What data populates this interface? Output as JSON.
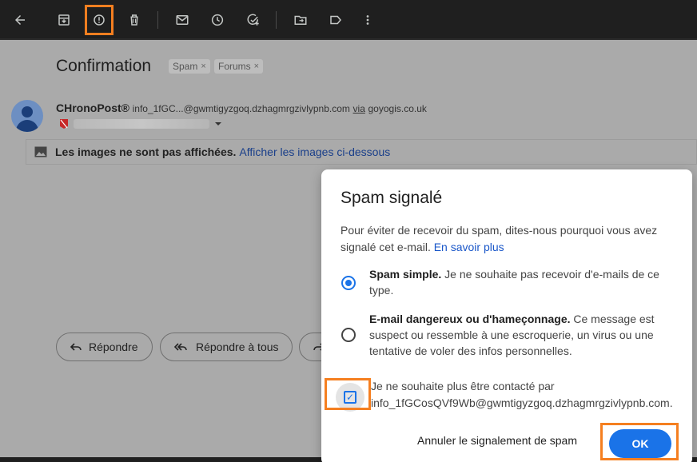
{
  "toolbar": {
    "icons": [
      "back-arrow-icon",
      "archive-icon",
      "report-spam-icon",
      "delete-icon",
      "mark-unread-icon",
      "snooze-icon",
      "add-task-icon",
      "move-to-icon",
      "label-icon",
      "more-icon"
    ]
  },
  "email": {
    "subject": "Confirmation",
    "labels": [
      {
        "name": "Spam",
        "x": "×"
      },
      {
        "name": "Forums",
        "x": "×"
      }
    ],
    "sender_name": "CHronoPost®",
    "sender_address": "info_1fGC...@gwmtigyzgoq.dzhagmrgzivlypnb.com",
    "via_label": "via",
    "via_domain": "goyogis.co.uk",
    "images_notice": "Les images ne sont pas affichées.",
    "images_link": "Afficher les images ci-dessous"
  },
  "actions": {
    "reply": "Répondre",
    "reply_all": "Répondre à tous"
  },
  "dialog": {
    "title": "Spam signalé",
    "description": "Pour éviter de recevoir du spam, dites-nous pourquoi vous avez signalé cet e-mail.",
    "learn_more": "En savoir plus",
    "option1_title": "Spam simple.",
    "option1_text": "Je ne souhaite pas recevoir d'e-mails de ce type.",
    "option1_selected": true,
    "option2_title": "E-mail dangereux ou d'hameçonnage.",
    "option2_text": "Ce message est suspect ou ressemble à une escroquerie, un virus ou une tentative de voler des infos personnelles.",
    "option2_selected": false,
    "unsubscribe_text": "Je ne souhaite plus être contacté par info_1fGCosQVf9Wb@gwmtigyzgoq.dzhagmrgzivlypnb.com.",
    "unsubscribe_checked": true,
    "cancel_label": "Annuler le signalement de spam",
    "ok_label": "OK"
  },
  "colors": {
    "accent": "#1a73e8",
    "highlight": "#f57f20",
    "toolbar_bg": "#1f1f1f"
  }
}
